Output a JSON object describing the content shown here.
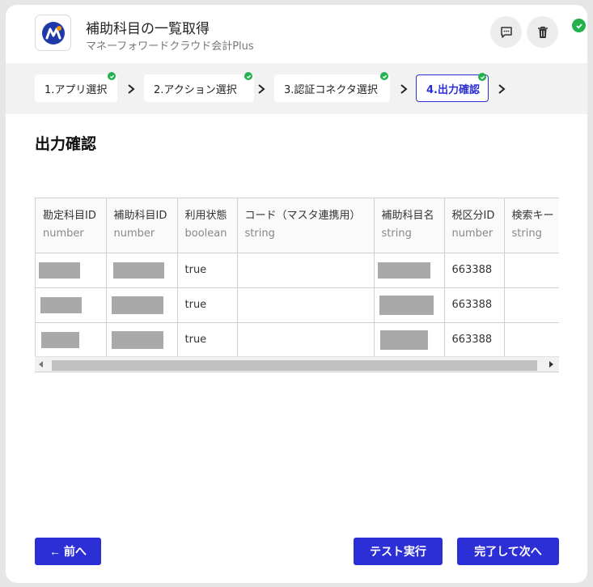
{
  "header": {
    "title": "補助科目の一覧取得",
    "subtitle": "マネーフォワードクラウド会計Plus",
    "logo_icon": "moneyforward-logo-icon",
    "comment_icon": "comment-icon",
    "delete_icon": "trash-icon",
    "status_icon": "check-icon"
  },
  "steps": [
    {
      "label": "1.アプリ選択",
      "done": true
    },
    {
      "label": "2.アクション選択",
      "done": true
    },
    {
      "label": "3.認証コネクタ選択",
      "done": true
    },
    {
      "label": "4.出力確認",
      "done": true,
      "active": true
    }
  ],
  "section_title": "出力確認",
  "table": {
    "columns": [
      {
        "name": "勘定科目ID",
        "type": "number"
      },
      {
        "name": "補助科目ID",
        "type": "number"
      },
      {
        "name": "利用状態",
        "type": "boolean"
      },
      {
        "name": "コード（マスタ連携用）",
        "type": "string"
      },
      {
        "name": "補助科目名",
        "type": "string"
      },
      {
        "name": "税区分ID",
        "type": "number"
      },
      {
        "name": "検索キー",
        "type": "string"
      }
    ],
    "rows": [
      {
        "usage": "true",
        "tax_id": "663388"
      },
      {
        "usage": "true",
        "tax_id": "663388"
      },
      {
        "usage": "true",
        "tax_id": "663388"
      }
    ]
  },
  "buttons": {
    "back": "← 前へ",
    "test": "テスト実行",
    "next": "完了して次へ"
  },
  "colors": {
    "primary": "#2d2fd6",
    "success": "#22b14c",
    "redaction": "#a9a9a9"
  }
}
